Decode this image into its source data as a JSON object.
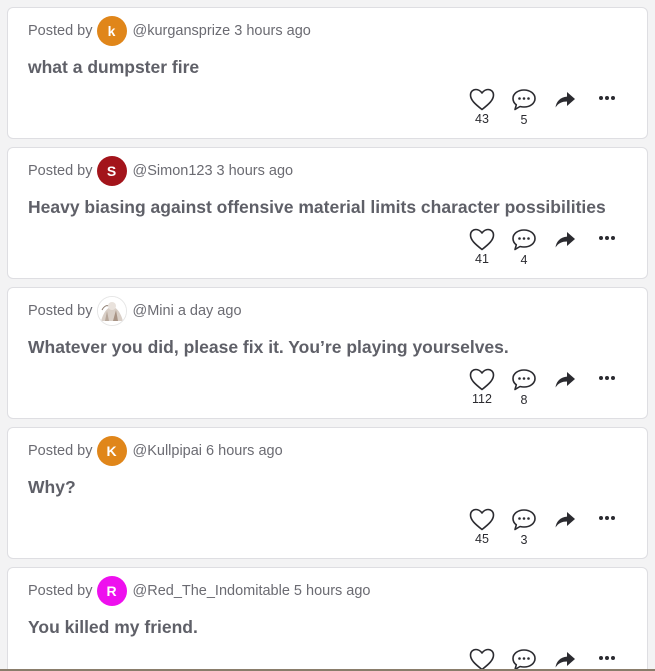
{
  "posted_by_label": "Posted by",
  "posts": [
    {
      "avatar_letter": "k",
      "avatar_color": "#e0861a",
      "handle": "@kurgansprize",
      "time": "3 hours ago",
      "title": "what a dumpster fire",
      "likes": "43",
      "comments": "5"
    },
    {
      "avatar_letter": "S",
      "avatar_color": "#a3141b",
      "handle": "@Simon123",
      "time": "3 hours ago",
      "title": "Heavy biasing against offensive material limits character possibilities",
      "likes": "41",
      "comments": "4"
    },
    {
      "avatar_letter": "",
      "avatar_color": "#ffffff",
      "handle": "@Mini",
      "time": "a day ago",
      "title": "Whatever you did, please fix it. You’re playing yourselves.",
      "likes": "112",
      "comments": "8"
    },
    {
      "avatar_letter": "K",
      "avatar_color": "#e0861a",
      "handle": "@Kullpipai",
      "time": "6 hours ago",
      "title": "Why?",
      "likes": "45",
      "comments": "3"
    },
    {
      "avatar_letter": "R",
      "avatar_color": "#ee10ee",
      "handle": "@Red_The_Indomitable",
      "time": "5 hours ago",
      "title": "You killed my friend.",
      "likes": "",
      "comments": ""
    }
  ],
  "icons": {
    "like": "heart-icon",
    "comment": "speech-bubble-icon",
    "share": "share-arrow-icon",
    "more": "more-dots-icon"
  }
}
